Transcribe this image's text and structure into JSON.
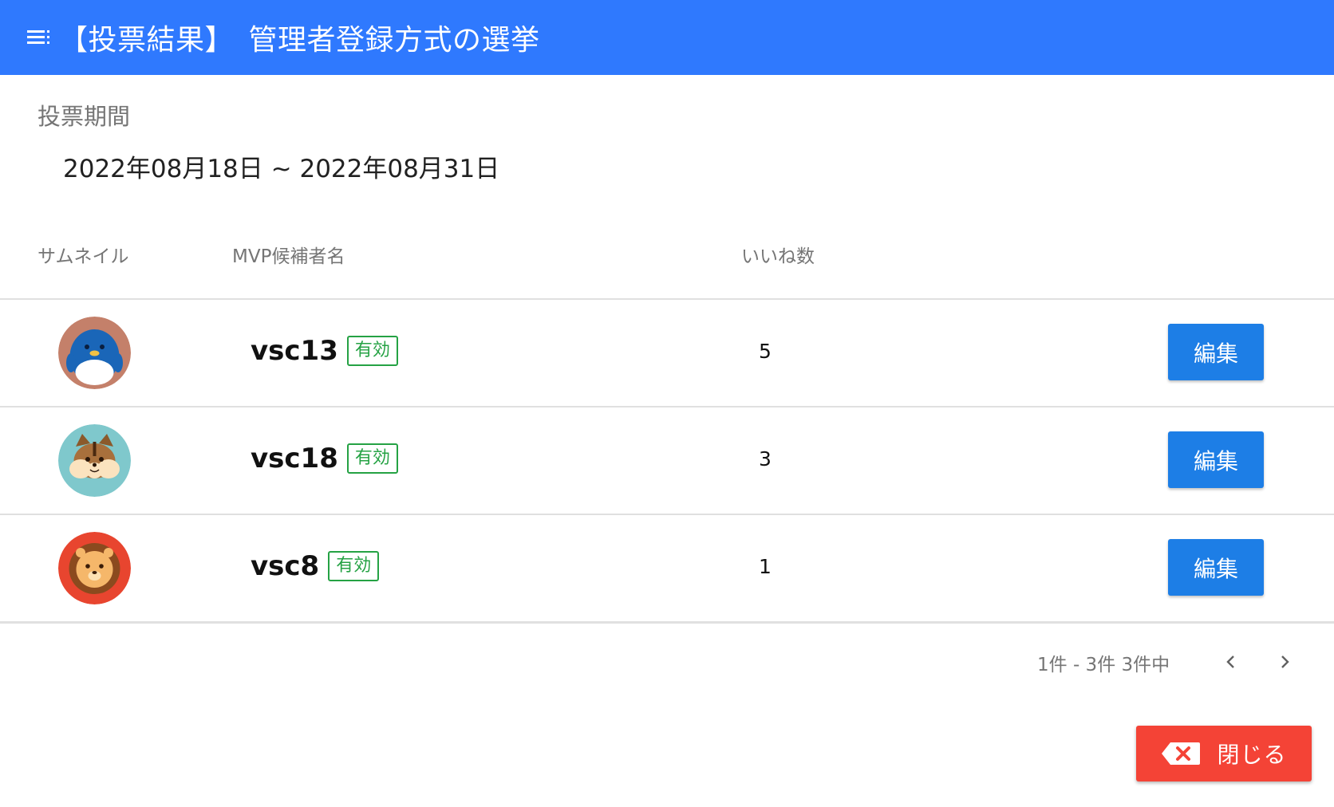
{
  "header": {
    "title": "【投票結果】　管理者登録方式の選挙",
    "menu_icon": "menu-icon",
    "background": "#2f79fe"
  },
  "period": {
    "label": "投票期間",
    "value": "2022年08月18日 ~ 2022年08月31日"
  },
  "table": {
    "columns": [
      "サムネイル",
      "MVP候補者名",
      "いいね数"
    ],
    "rows": [
      {
        "thumbnail": "penguin-avatar",
        "name": "vsc13",
        "status": "有効",
        "likes": "5",
        "action": "編集"
      },
      {
        "thumbnail": "chipmunk-avatar",
        "name": "vsc18",
        "status": "有効",
        "likes": "3",
        "action": "編集"
      },
      {
        "thumbnail": "lion-avatar",
        "name": "vsc8",
        "status": "有効",
        "likes": "1",
        "action": "編集"
      }
    ]
  },
  "pagination": {
    "text": "1件 - 3件 3件中",
    "prev_icon": "chevron-left-icon",
    "next_icon": "chevron-right-icon"
  },
  "close_button": {
    "label": "閉じる",
    "icon": "backspace-x-icon",
    "color": "#f44336"
  },
  "colors": {
    "accent": "#2f79fe",
    "edit_button": "#1d7ee6",
    "status_badge": "#25a244"
  }
}
